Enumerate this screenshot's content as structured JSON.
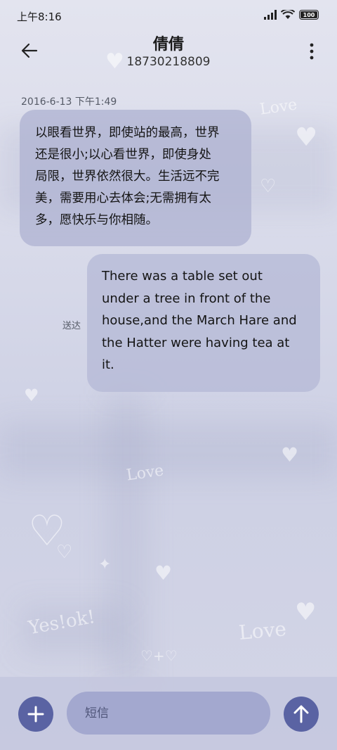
{
  "status_bar": {
    "time": "上午8:16",
    "battery": "100"
  },
  "header": {
    "contact_name": "倩倩",
    "contact_number": "18730218809",
    "back_icon": "arrow-left-icon",
    "more_icon": "more-vertical-icon"
  },
  "conversation": {
    "timestamp": "2016-6-13 下午1:49",
    "messages": [
      {
        "direction": "received",
        "lines": [
          "以眼看世界，即使站的最高，世界",
          "还是很小;以心看世界，即使身处",
          "局限，世界依然很大。生活远不完",
          "美，需要用心去体会;无需拥有太",
          "多，愿快乐与你相随。"
        ]
      },
      {
        "direction": "sent",
        "status": "送达",
        "lines": [
          "There was a table set out",
          "under a tree in front of the",
          "house,and the March Hare and",
          "the Hatter were having tea at",
          "it."
        ]
      }
    ]
  },
  "composer": {
    "placeholder": "短信",
    "add_icon": "plus-icon",
    "send_icon": "arrow-up-icon"
  },
  "colors": {
    "accent": "#5a63a3",
    "bubble": "#b3b6d6",
    "input": "#a3a8cf"
  }
}
